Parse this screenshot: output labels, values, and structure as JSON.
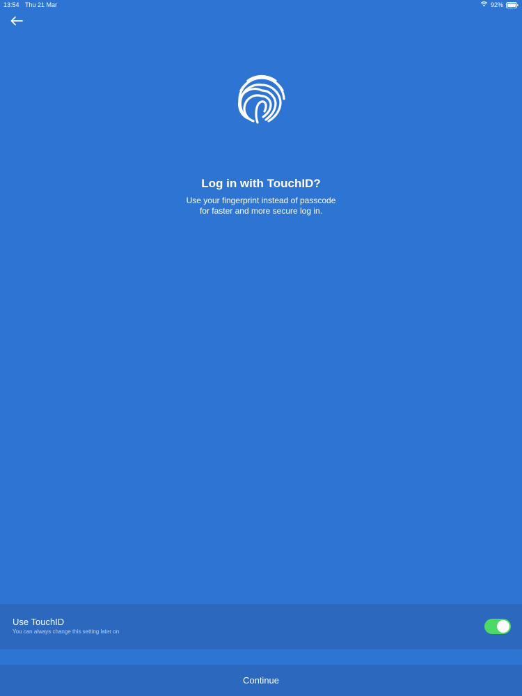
{
  "status_bar": {
    "time": "13:54",
    "date": "Thu 21 Mar",
    "battery": "92%",
    "icons": [
      "wifi-icon",
      "battery-icon"
    ]
  },
  "nav": {
    "back_icon": "arrow-left-icon"
  },
  "hero": {
    "icon": "fingerprint-icon",
    "title": "Log in with TouchID?",
    "description": "Use your fingerprint instead of passcode for faster and more secure log in."
  },
  "touchid_setting": {
    "label": "Use TouchID",
    "sublabel": "You can always change this setting later on",
    "enabled": true
  },
  "footer": {
    "continue_label": "Continue"
  },
  "colors": {
    "background": "#2e74d3",
    "panel": "#2c68bd",
    "toggle_on": "#4cd964"
  }
}
